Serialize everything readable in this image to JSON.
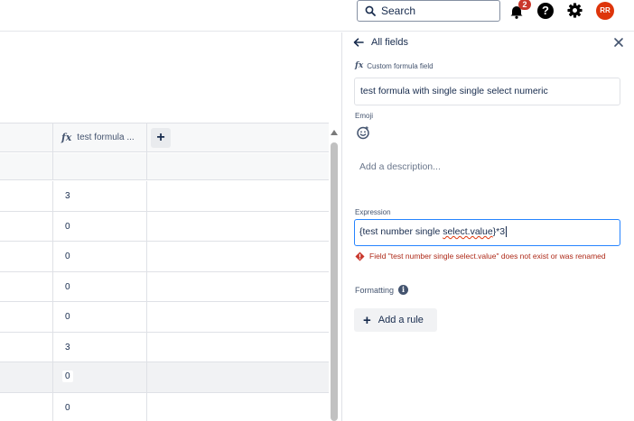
{
  "topbar": {
    "search_label": "Search",
    "notification_count": "2",
    "help_glyph": "?",
    "avatar_initials": "RR",
    "avatar_color": "#de350b"
  },
  "grid": {
    "column_header": "test formula ...",
    "add_column_glyph": "+",
    "rows": [
      "3",
      "0",
      "0",
      "0",
      "0",
      "3",
      "0",
      "0"
    ]
  },
  "panel": {
    "back_label": "All fields",
    "field_type_label": "Custom formula field",
    "field_name": "test formula with single single select numeric",
    "emoji_label": "Emoji",
    "description_placeholder": "Add a description...",
    "expression_label": "Expression",
    "expression_prefix": "{test number single ",
    "expression_error_part": "select.value",
    "expression_suffix": "}*3",
    "error_message": "Field \"test number single select.value\" does not exist or was renamed",
    "formatting_label": "Formatting",
    "add_rule_label": "Add a rule"
  },
  "colors": {
    "accent": "#2684ff",
    "error": "#ae2a19",
    "badge": "#c9372c"
  }
}
